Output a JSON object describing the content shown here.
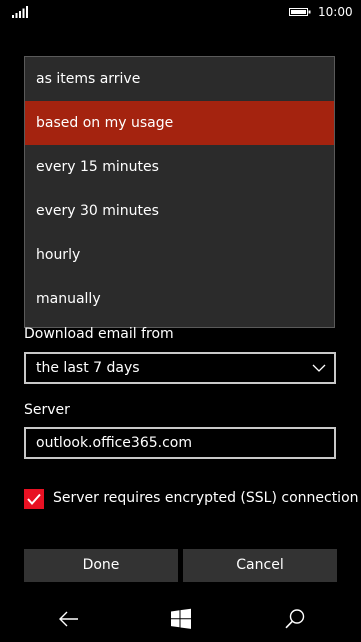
{
  "status_bar": {
    "time": "10:00",
    "icons": [
      "signal-icon",
      "battery-icon"
    ]
  },
  "sync_dropdown": {
    "options": [
      {
        "label": "as items arrive",
        "selected": false
      },
      {
        "label": "based on my usage",
        "selected": true
      },
      {
        "label": "every 15 minutes",
        "selected": false
      },
      {
        "label": "every 30 minutes",
        "selected": false
      },
      {
        "label": "hourly",
        "selected": false
      },
      {
        "label": "manually",
        "selected": false
      }
    ]
  },
  "download_email": {
    "label": "Download email from",
    "value": "the last 7 days"
  },
  "server": {
    "label": "Server",
    "value": "outlook.office365.com"
  },
  "ssl": {
    "label": "Server requires encrypted (SSL) connection",
    "checked": true
  },
  "buttons": {
    "done": "Done",
    "cancel": "Cancel"
  },
  "nav_bar": {
    "icons": [
      "back-arrow-icon",
      "windows-start-icon",
      "search-icon"
    ]
  },
  "colors": {
    "accent": "#e81123",
    "selected_option": "#a4230f",
    "button_bg": "#333333",
    "flyout_bg": "#2b2b2b"
  }
}
